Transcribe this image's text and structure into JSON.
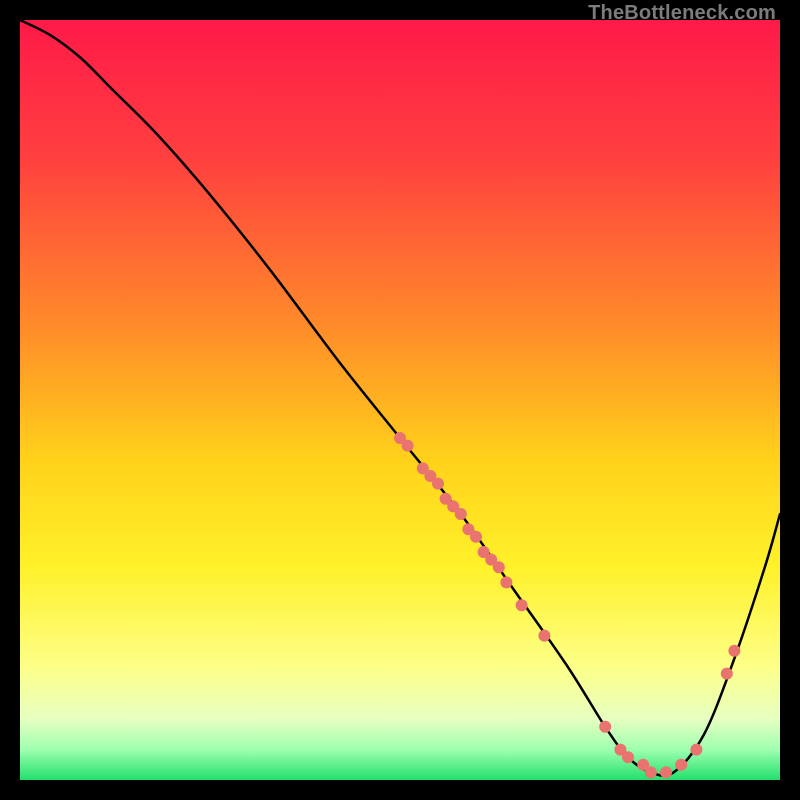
{
  "watermark": "TheBottleneck.com",
  "chart_data": {
    "type": "line",
    "title": "",
    "xlabel": "",
    "ylabel": "",
    "xlim": [
      0,
      100
    ],
    "ylim": [
      0,
      100
    ],
    "gradient_stops": [
      {
        "offset": 0,
        "color": "#ff1a49"
      },
      {
        "offset": 18,
        "color": "#ff3f3f"
      },
      {
        "offset": 40,
        "color": "#ff8a2a"
      },
      {
        "offset": 58,
        "color": "#ffd21a"
      },
      {
        "offset": 72,
        "color": "#fff12a"
      },
      {
        "offset": 85,
        "color": "#fdff87"
      },
      {
        "offset": 92,
        "color": "#e6ffc0"
      },
      {
        "offset": 96,
        "color": "#9dffb0"
      },
      {
        "offset": 100,
        "color": "#23e06b"
      }
    ],
    "series": [
      {
        "name": "bottleneck-curve",
        "x": [
          0,
          4,
          8,
          12,
          18,
          25,
          33,
          42,
          50,
          58,
          65,
          72,
          77,
          80,
          83,
          86,
          90,
          94,
          98,
          100
        ],
        "y": [
          100,
          98,
          95,
          91,
          85,
          77,
          67,
          55,
          45,
          35,
          25,
          15,
          7,
          3,
          1,
          1,
          6,
          16,
          28,
          35
        ]
      }
    ],
    "scatter": {
      "name": "sample-points",
      "color": "#e9736f",
      "points": [
        {
          "x": 50,
          "y": 45
        },
        {
          "x": 51,
          "y": 44
        },
        {
          "x": 53,
          "y": 41
        },
        {
          "x": 54,
          "y": 40
        },
        {
          "x": 55,
          "y": 39
        },
        {
          "x": 56,
          "y": 37
        },
        {
          "x": 57,
          "y": 36
        },
        {
          "x": 58,
          "y": 35
        },
        {
          "x": 59,
          "y": 33
        },
        {
          "x": 60,
          "y": 32
        },
        {
          "x": 61,
          "y": 30
        },
        {
          "x": 62,
          "y": 29
        },
        {
          "x": 63,
          "y": 28
        },
        {
          "x": 64,
          "y": 26
        },
        {
          "x": 66,
          "y": 23
        },
        {
          "x": 69,
          "y": 19
        },
        {
          "x": 77,
          "y": 7
        },
        {
          "x": 79,
          "y": 4
        },
        {
          "x": 80,
          "y": 3
        },
        {
          "x": 82,
          "y": 2
        },
        {
          "x": 83,
          "y": 1
        },
        {
          "x": 85,
          "y": 1
        },
        {
          "x": 87,
          "y": 2
        },
        {
          "x": 89,
          "y": 4
        },
        {
          "x": 93,
          "y": 14
        },
        {
          "x": 94,
          "y": 17
        }
      ]
    }
  }
}
